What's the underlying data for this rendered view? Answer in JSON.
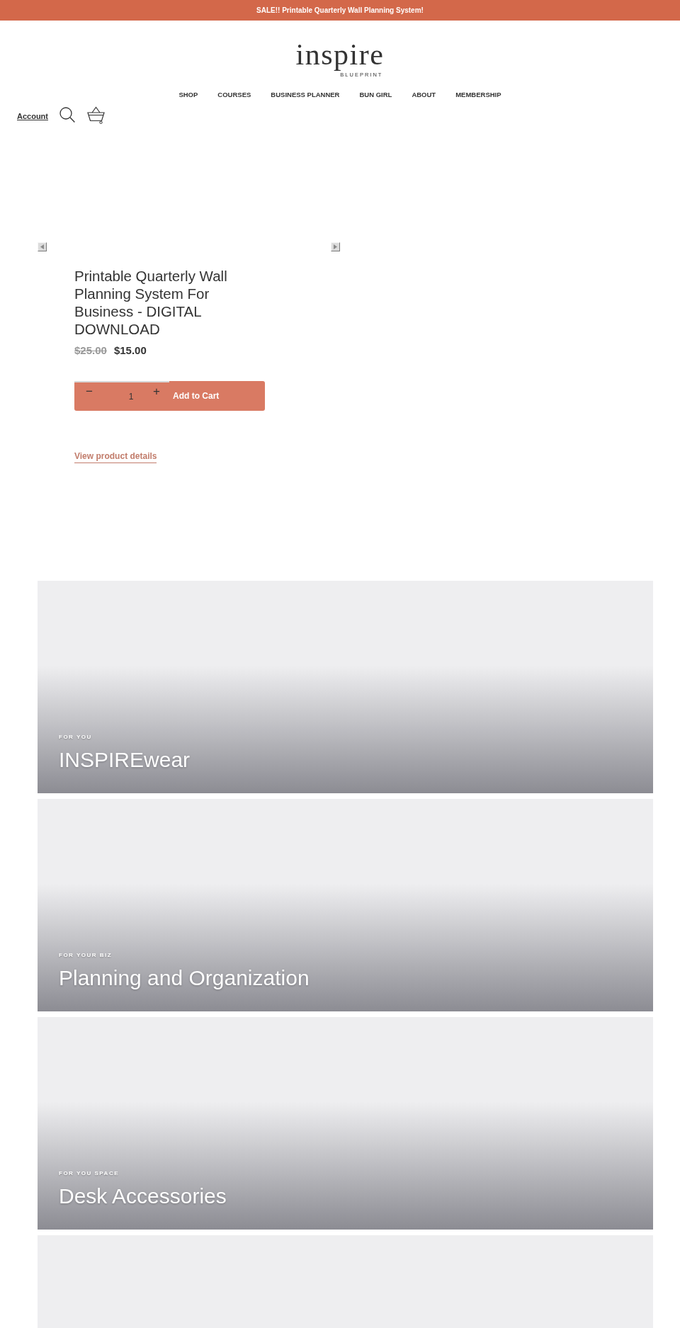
{
  "announcement": {
    "text": "SALE!! Printable Quarterly Wall Planning System!"
  },
  "logo": {
    "wordmark": "inspire",
    "tagline": "BLUEPRINT"
  },
  "nav": [
    "SHOP",
    "COURSES",
    "BUSINESS PLANNER",
    "BUN GIRL",
    "ABOUT",
    "MEMBERSHIP"
  ],
  "utility": {
    "account": "Account"
  },
  "product": {
    "title": "Printable Quarterly Wall Planning System For Business - DIGITAL DOWNLOAD",
    "compare_price": "$25.00",
    "price": "$15.00",
    "quantity": {
      "minus": "−",
      "value": "1",
      "plus": "+"
    },
    "add_to_cart": "Add to Cart",
    "details_link": "View product details"
  },
  "collections": [
    {
      "eyebrow": "FOR YOU",
      "title": "INSPIREwear"
    },
    {
      "eyebrow": "FOR YOUR BIZ",
      "title": "Planning and Organization"
    },
    {
      "eyebrow": "FOR YOU SPACE",
      "title": "Desk Accessories"
    }
  ]
}
